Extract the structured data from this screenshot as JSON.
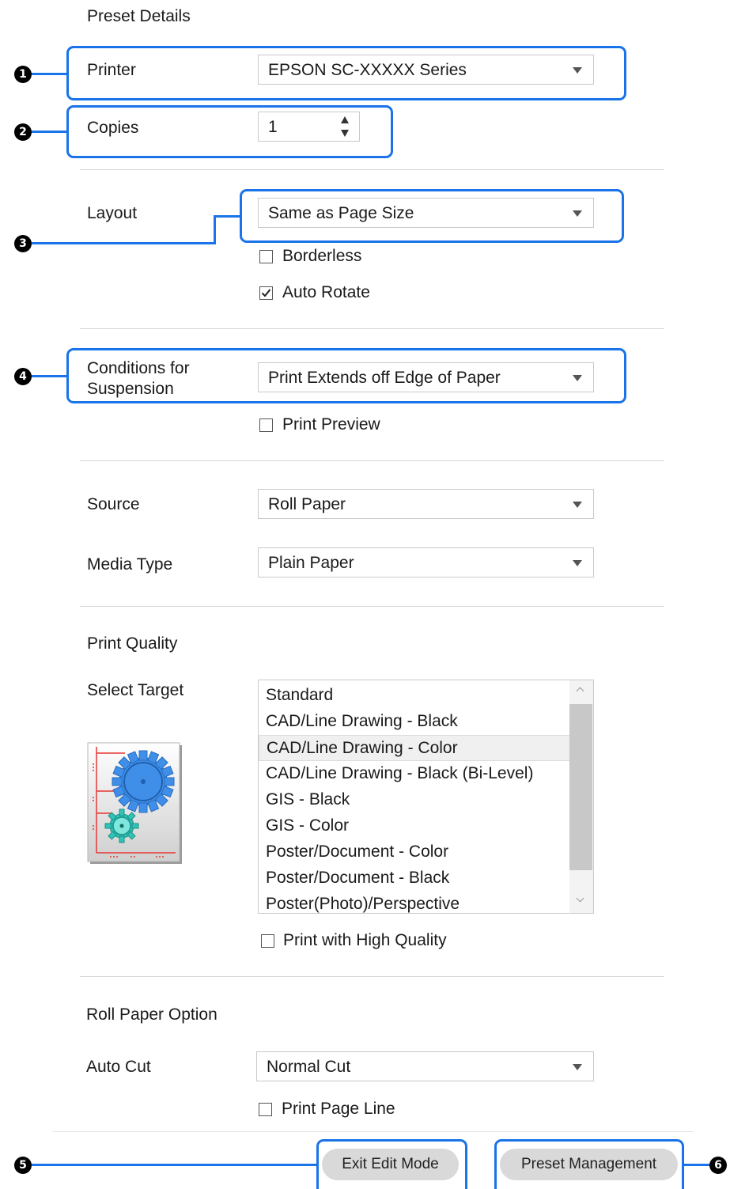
{
  "header": {
    "title": "Preset Details"
  },
  "printer": {
    "label": "Printer",
    "value": "EPSON SC-XXXXX Series"
  },
  "copies": {
    "label": "Copies",
    "value": "1"
  },
  "layout": {
    "label": "Layout",
    "value": "Same as Page Size",
    "borderless": {
      "label": "Borderless",
      "checked": false
    },
    "auto_rotate": {
      "label": "Auto Rotate",
      "checked": true
    }
  },
  "suspension": {
    "label_line1": "Conditions for",
    "label_line2": "Suspension",
    "value": "Print Extends off Edge of Paper",
    "print_preview": {
      "label": "Print Preview",
      "checked": false
    }
  },
  "source": {
    "label": "Source",
    "value": "Roll Paper"
  },
  "media_type": {
    "label": "Media Type",
    "value": "Plain Paper"
  },
  "print_quality": {
    "heading": "Print Quality",
    "select_target_label": "Select Target",
    "targets": [
      "Standard",
      "CAD/Line Drawing - Black",
      "CAD/Line Drawing - Color",
      "CAD/Line Drawing - Black (Bi-Level)",
      "GIS - Black",
      "GIS - Color",
      "Poster/Document - Color",
      "Poster/Document - Black",
      "Poster(Photo)/Perspective"
    ],
    "selected_target": "CAD/Line Drawing - Color",
    "high_quality": {
      "label": "Print with High Quality",
      "checked": false
    }
  },
  "roll_paper": {
    "heading": "Roll Paper Option",
    "auto_cut_label": "Auto Cut",
    "auto_cut_value": "Normal Cut",
    "print_page_line": {
      "label": "Print Page Line",
      "checked": false
    }
  },
  "footer": {
    "exit_edit_label": "Exit Edit Mode",
    "preset_mgmt_label": "Preset Management"
  },
  "callouts": [
    "1",
    "2",
    "3",
    "4",
    "5",
    "6"
  ],
  "colors": {
    "callout": "#1a73e8",
    "gear_blue": "#3f8fe8",
    "gear_teal": "#2ec4b6",
    "guide_red": "#e53935"
  }
}
